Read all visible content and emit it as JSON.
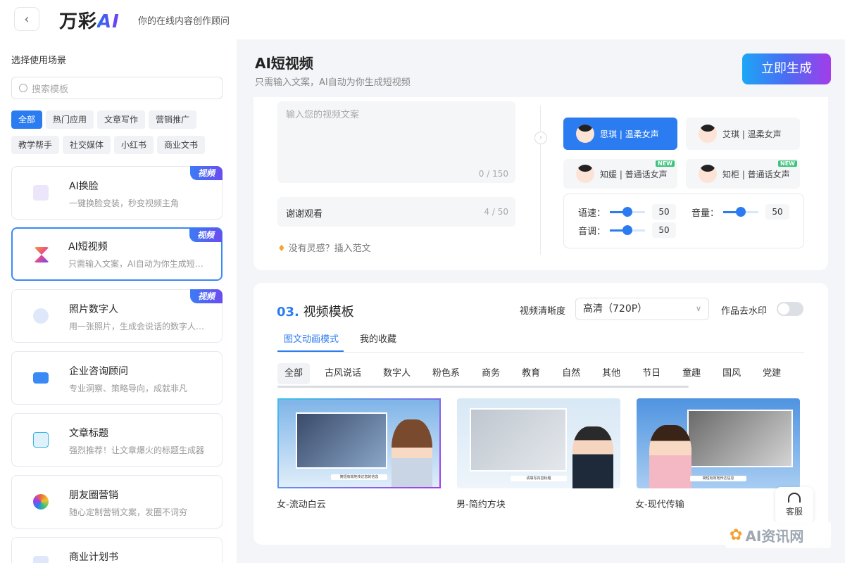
{
  "header": {
    "back_icon": "‹",
    "logo_text": "万彩",
    "logo_ai": "AI",
    "tagline": "你的在线内容创作顾问"
  },
  "sidebar": {
    "title": "选择使用场景",
    "search_placeholder": "搜索模板",
    "chips": [
      "全部",
      "热门应用",
      "文章写作",
      "营销推广",
      "教学帮手",
      "社交媒体",
      "小红书",
      "商业文书"
    ],
    "cards": [
      {
        "title": "AI换脸",
        "desc": "一键换脸变装，秒变视频主角",
        "badge": "视频",
        "color": "#8b6ee8"
      },
      {
        "title": "AI短视频",
        "desc": "只需输入文案，AI自动为你生成短视频",
        "badge": "视频",
        "color": "#e85a7a"
      },
      {
        "title": "照片数字人",
        "desc": "用一张照片，生成会说话的数字人视频",
        "badge": "视频",
        "color": "#4a7fe8"
      },
      {
        "title": "企业咨询顾问",
        "desc": "专业洞察、策略导向，成就非凡",
        "badge": "",
        "color": "#3a8af5"
      },
      {
        "title": "文章标题",
        "desc": "强烈推荐！让文章爆火的标题生成器",
        "badge": "",
        "color": "#34b3e8"
      },
      {
        "title": "朋友圈营销",
        "desc": "随心定制营销文案，发圈不词穷",
        "badge": "",
        "color": "#f06a3c"
      },
      {
        "title": "商业计划书",
        "desc": "",
        "badge": "",
        "color": "#4a7fe8"
      }
    ]
  },
  "main": {
    "title": "AI短视频",
    "subtitle": "只需输入文案，AI自动为你生成短视频",
    "generate_label": "立即生成",
    "script_placeholder": "输入您的视频文案",
    "script_count": "0 / 150",
    "line2_text": "谢谢观看",
    "line2_count": "4 / 50",
    "inspire": "没有灵感？插入范文",
    "voices": [
      {
        "name": "思琪 | 温柔女声",
        "selected": true,
        "new": false
      },
      {
        "name": "艾琪 | 温柔女声",
        "selected": false,
        "new": false
      },
      {
        "name": "知媛 | 普通话女声",
        "selected": false,
        "new": true
      },
      {
        "name": "知柜 | 普通话女声",
        "selected": false,
        "new": true
      }
    ],
    "new_badge": "NEW",
    "sliders": {
      "speed_label": "语速：",
      "speed": "50",
      "volume_label": "音量：",
      "volume": "50",
      "pitch_label": "音调：",
      "pitch": "50"
    },
    "template_section": {
      "num": "03.",
      "title": "视频模板",
      "resolution_label": "视频清晰度",
      "resolution_value": "高清（720P）",
      "watermark_label": "作品去水印",
      "tabs": [
        "图文动画模式",
        "我的收藏"
      ],
      "categories": [
        "全部",
        "古风说话",
        "数字人",
        "粉色系",
        "商务",
        "教育",
        "自然",
        "其他",
        "节日",
        "童趣",
        "国风",
        "党建"
      ],
      "templates": [
        {
          "label": "女-流动白云",
          "caption": "简短有效地传达您的信息"
        },
        {
          "label": "男-简约方块",
          "caption": "请填写内容标题"
        },
        {
          "label": "女-现代传输",
          "caption": "简短有效地传达信息"
        }
      ]
    },
    "service_label": "客服",
    "watermark_text": "AI资讯网"
  },
  "colors": {
    "accent": "#2b7cf0",
    "badge": "#5a5cf2"
  }
}
